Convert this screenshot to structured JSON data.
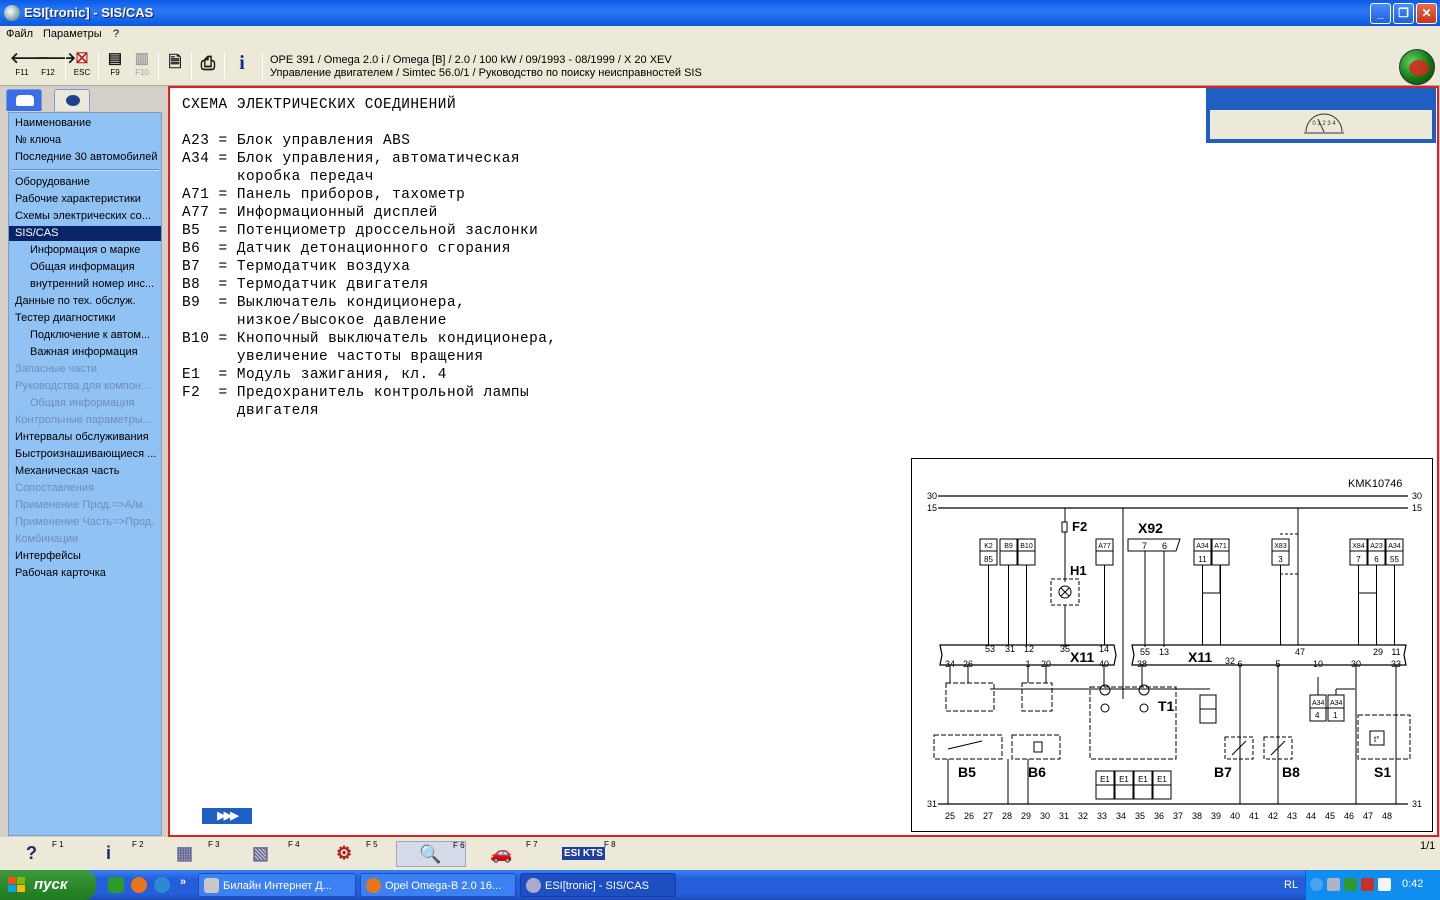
{
  "window": {
    "title": "ESI[tronic] - SIS/CAS",
    "controls": {
      "minimize": "_",
      "maximize": "❐",
      "close": "✕"
    }
  },
  "menu": {
    "file": "Файл",
    "params": "Параметры",
    "help": "?"
  },
  "toolbar": {
    "buttons": [
      {
        "icon": "arrow-left-icon",
        "glyph": "🡐",
        "key": "F11"
      },
      {
        "icon": "arrow-right-icon",
        "glyph": "🡒",
        "key": "F12"
      },
      {
        "icon": "esc-icon",
        "glyph": "⛝",
        "key": "ESC"
      },
      {
        "icon": "book-icon",
        "glyph": "▤",
        "key": "F9"
      },
      {
        "icon": "book-disabled-icon",
        "glyph": "▥",
        "key": "F10"
      },
      {
        "icon": "document-icon",
        "glyph": "🗎",
        "key": ""
      },
      {
        "icon": "printer-icon",
        "glyph": "⎙",
        "key": ""
      },
      {
        "icon": "info-icon",
        "glyph": "i",
        "key": ""
      }
    ],
    "vehicle": "OPE 391 / Omega 2.0 i / Omega [B] / 2.0 / 100 kW / 09/1993 - 08/1999 / X 20 XEV",
    "module": "Управление двигателем / Simtec 56.0/1 / Руководство по поиску неисправностей SIS"
  },
  "sidebar": {
    "group1": [
      "Наименование",
      "№ ключа",
      "Последние 30 автомобилей"
    ],
    "group2": [
      {
        "label": "Оборудование",
        "level": 0,
        "state": "normal"
      },
      {
        "label": "Рабочие характеристики",
        "level": 0,
        "state": "normal"
      },
      {
        "label": "Схемы электрических со...",
        "level": 0,
        "state": "normal"
      },
      {
        "label": "SIS/CAS",
        "level": 0,
        "state": "selected"
      },
      {
        "label": "Информация о марке",
        "level": 1,
        "state": "normal"
      },
      {
        "label": "Общая информация",
        "level": 1,
        "state": "normal"
      },
      {
        "label": "внутренний номер инс...",
        "level": 1,
        "state": "normal"
      },
      {
        "label": "Данные по тех. обслуж.",
        "level": 0,
        "state": "normal"
      },
      {
        "label": "Тестер диагностики",
        "level": 0,
        "state": "normal"
      },
      {
        "label": "Подключение к автом...",
        "level": 1,
        "state": "normal"
      },
      {
        "label": "Важная информация",
        "level": 1,
        "state": "normal"
      },
      {
        "label": "Запасные части",
        "level": 0,
        "state": "disabled"
      },
      {
        "label": "Руководства для компон...",
        "level": 0,
        "state": "disabled"
      },
      {
        "label": "Общая информация",
        "level": 1,
        "state": "disabled"
      },
      {
        "label": "Контрольные параметры...",
        "level": 0,
        "state": "disabled"
      },
      {
        "label": "Интервалы обслуживания",
        "level": 0,
        "state": "normal"
      },
      {
        "label": "Быстроизнашивающиеся ...",
        "level": 0,
        "state": "normal"
      },
      {
        "label": "Механическая часть",
        "level": 0,
        "state": "normal"
      },
      {
        "label": "Сопоставления",
        "level": 0,
        "state": "disabled"
      },
      {
        "label": "Применение Прод.=>А/м.",
        "level": 0,
        "state": "disabled"
      },
      {
        "label": "Применение Часть=>Прод.",
        "level": 0,
        "state": "disabled"
      },
      {
        "label": "Комбинации",
        "level": 0,
        "state": "disabled"
      },
      {
        "label": "Интерфейсы",
        "level": 0,
        "state": "normal"
      },
      {
        "label": "Рабочая карточка",
        "level": 0,
        "state": "normal"
      }
    ]
  },
  "content": {
    "heading": "СХЕМА ЭЛЕКТРИЧЕСКИХ СОЕДИНЕНИЙ",
    "legend": [
      "A23 = Блок управления ABS",
      "A34 = Блок управления, автоматическая",
      "      коробка передач",
      "A71 = Панель приборов, тахометр",
      "A77 = Информационный дисплей",
      "B5  = Потенциометр дроссельной заслонки",
      "B6  = Датчик детонационного сгорания",
      "B7  = Термодатчик воздуха",
      "B8  = Термодатчик двигателя",
      "B9  = Выключатель кондиционера,",
      "      низкое/высокое давление",
      "B10 = Кнопочный выключатель кондиционера,",
      "      увеличение частоты вращения",
      "E1  = Модуль зажигания, кл. 4",
      "F2  = Предохранитель контрольной лампы",
      "      двигателя"
    ],
    "page_nav": "▶▶▶",
    "gauge_scale": "0 1 2 3 4"
  },
  "diagram": {
    "ref": "KMK10746",
    "rails_top": [
      "30",
      "15"
    ],
    "rail_bottom": "31",
    "fuse": "F2",
    "lamp": "H1",
    "connector_x92": "X92",
    "x92_pins": [
      "7",
      "6"
    ],
    "connector_x11": "X11",
    "t1": "T1",
    "boxes_top": [
      {
        "name": "K2",
        "pin": "85"
      },
      {
        "name": "B9",
        "pin": ""
      },
      {
        "name": "B10",
        "pin": ""
      },
      {
        "name": "A77",
        "pin": ""
      },
      {
        "name": "A34",
        "pin": "11"
      },
      {
        "name": "A71",
        "pin": ""
      },
      {
        "name": "X83",
        "pin": "3"
      },
      {
        "name": "X84",
        "pin": "7"
      },
      {
        "name": "A23",
        "pin": "6"
      },
      {
        "name": "A34",
        "pin": "55"
      }
    ],
    "x11_left_top_pins": [
      "53",
      "31",
      "12",
      "35",
      "14"
    ],
    "x11_left_bottom_pins": [
      "34",
      "26",
      "1",
      "20",
      "40"
    ],
    "x11_right_top_pins": [
      "55",
      "13",
      "32",
      "47",
      "29",
      "11"
    ],
    "x11_right_bottom_pins": [
      "38",
      "6",
      "5",
      "10",
      "30",
      "33"
    ],
    "components_bottom": [
      "B5",
      "B6",
      "B7",
      "B8",
      "S1"
    ],
    "e1_boxes": [
      "E1",
      "E1",
      "E1",
      "E1"
    ],
    "bottom_pins": [
      "25",
      "26",
      "27",
      "28",
      "29",
      "30",
      "31",
      "32",
      "33",
      "34",
      "35",
      "36",
      "37",
      "38",
      "39",
      "40",
      "41",
      "42",
      "43",
      "44",
      "45",
      "46",
      "47",
      "48"
    ]
  },
  "bottombar": {
    "buttons": [
      {
        "icon": "help-icon",
        "glyph": "?",
        "key": "F 1"
      },
      {
        "icon": "info-icon",
        "glyph": "i",
        "key": "F 2"
      },
      {
        "icon": "component-list-icon",
        "glyph": "▦",
        "key": "F 3"
      },
      {
        "icon": "wiring-diagram-icon",
        "glyph": "▧",
        "key": "F 4"
      },
      {
        "icon": "tester-icon",
        "glyph": "⚙",
        "key": "F 5"
      },
      {
        "icon": "zoom-icon",
        "glyph": "🔍",
        "key": "F 6"
      },
      {
        "icon": "vehicle-icon",
        "glyph": "🚗",
        "key": "F 7"
      },
      {
        "icon": "esi-kts-icon",
        "glyph": "ESI KTS",
        "key": "F 8"
      }
    ],
    "page": "1/1"
  },
  "taskbar": {
    "start": "пуск",
    "tasks": [
      "Билайн Интернет Д...",
      "Opel Omega-B 2.0 16...",
      "ESI[tronic] - SIS/CAS"
    ],
    "lang": "RL",
    "clock": "0:42"
  }
}
